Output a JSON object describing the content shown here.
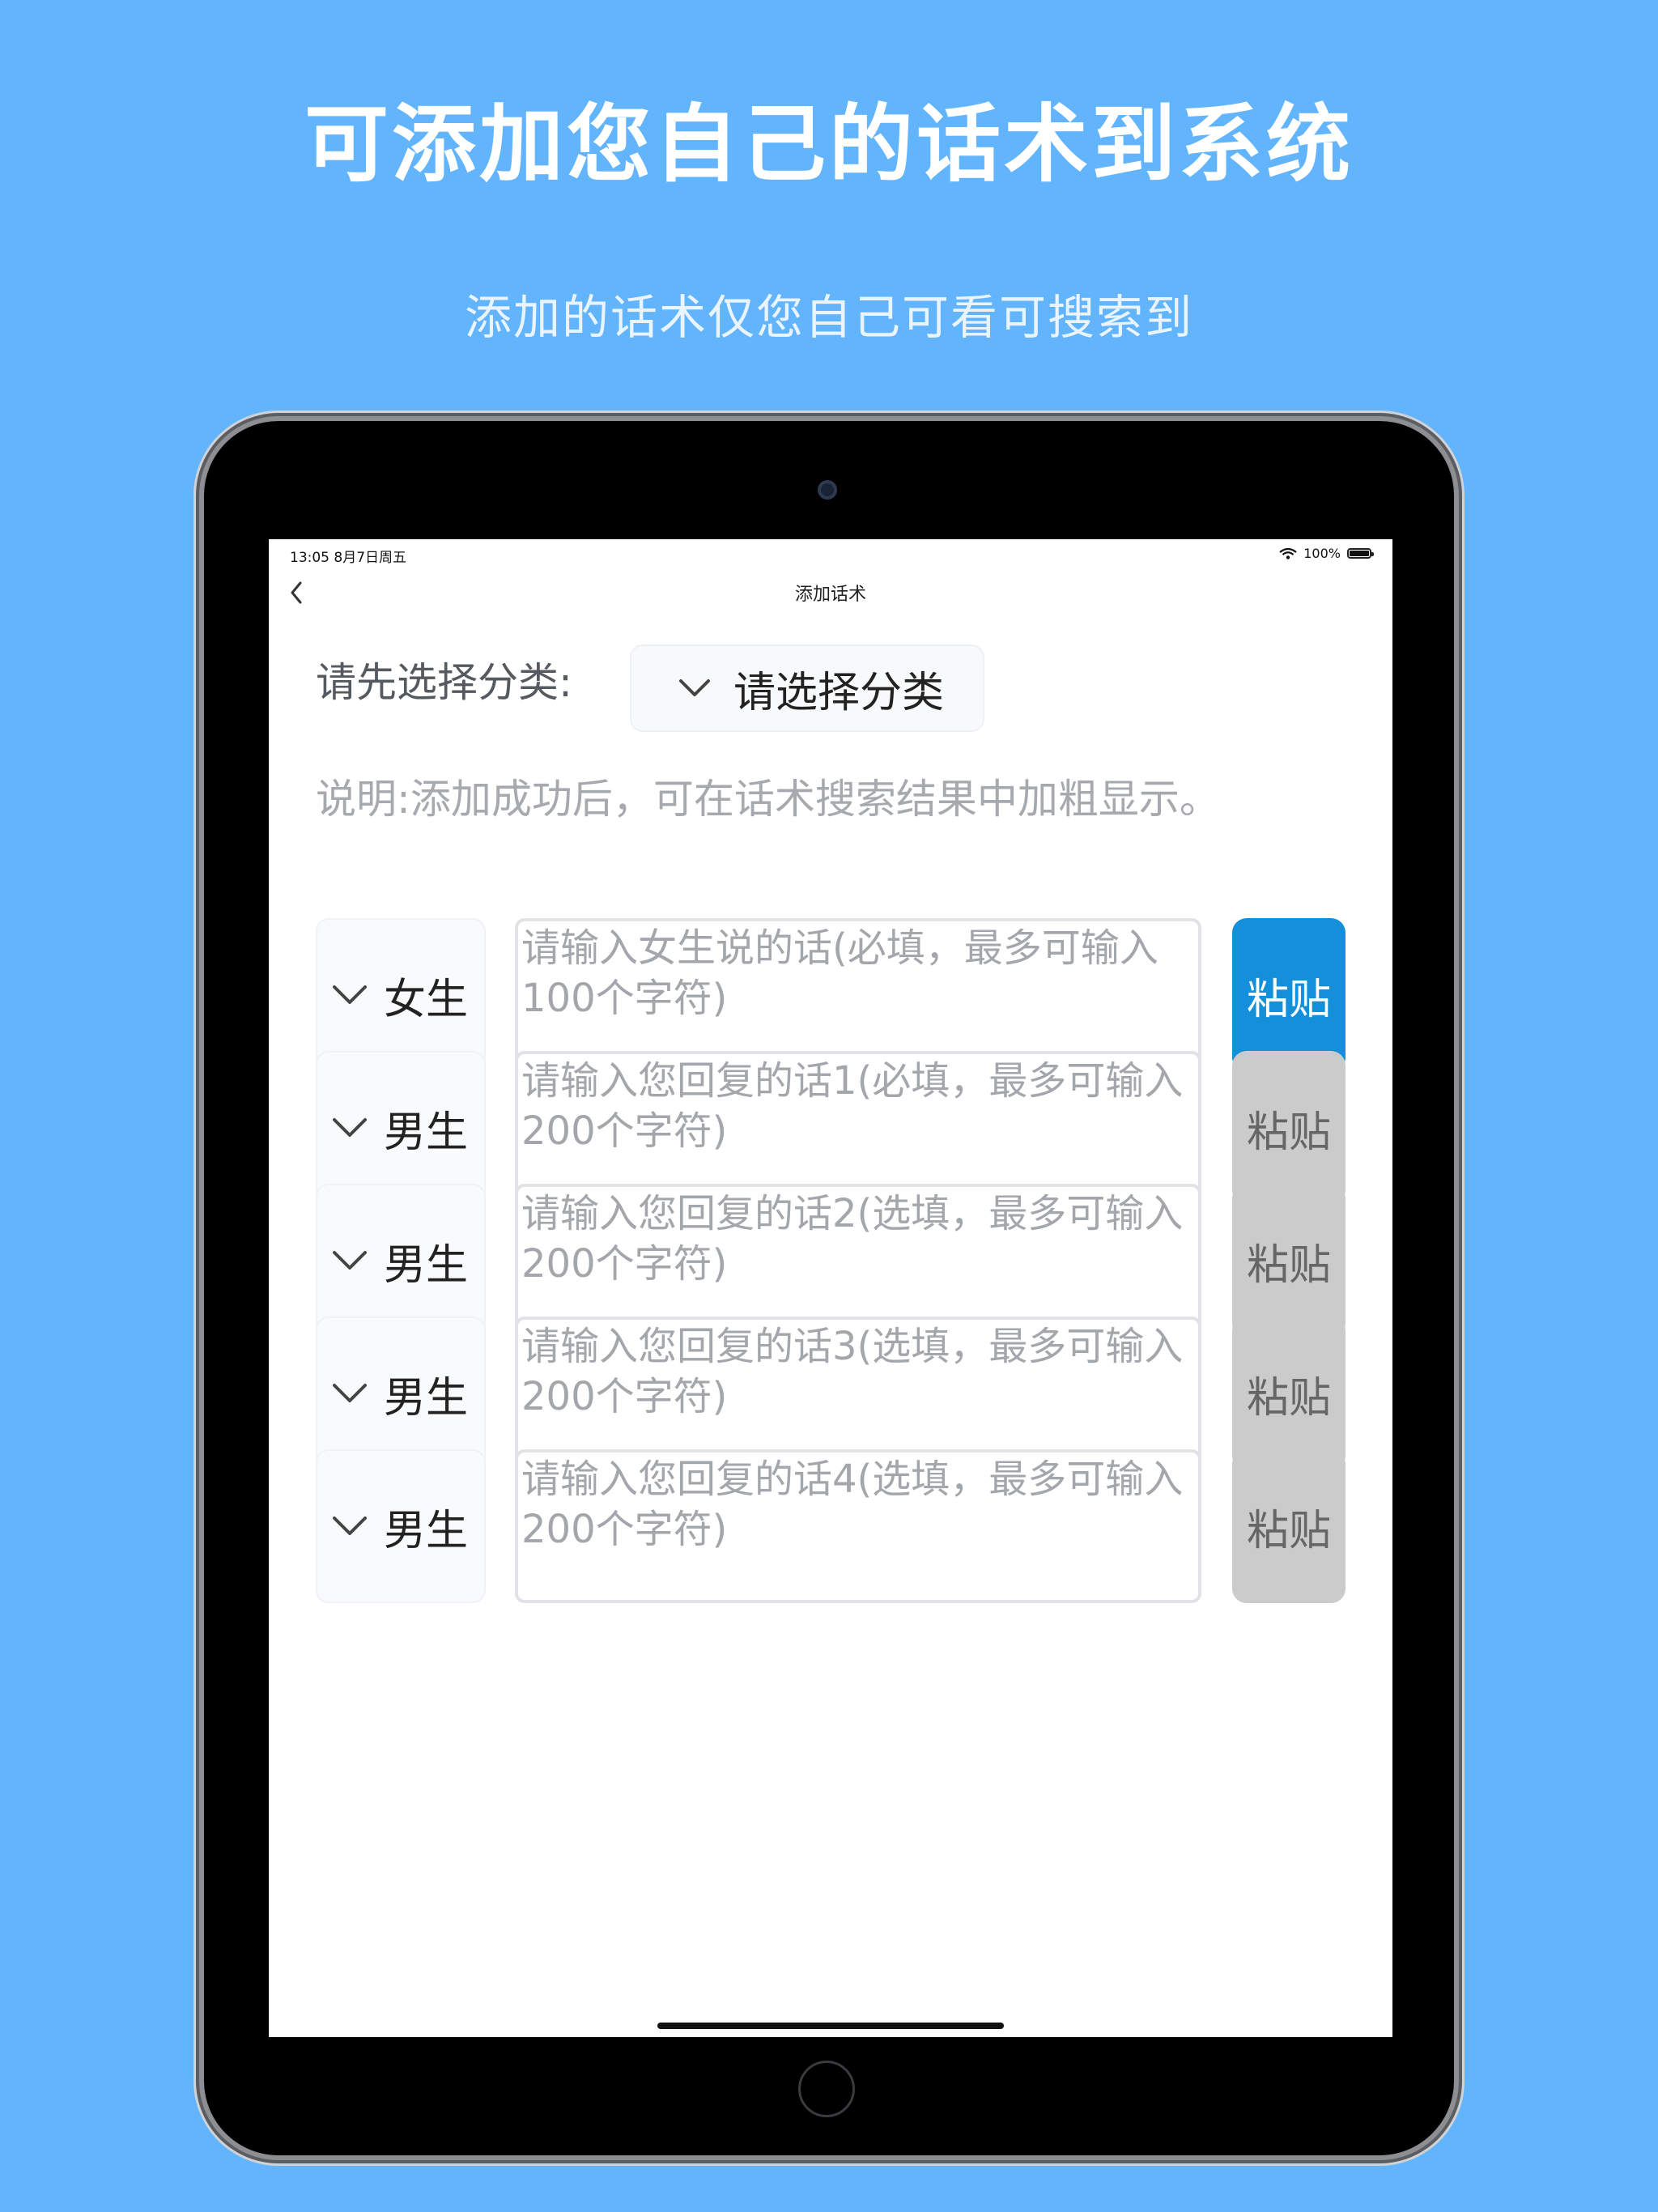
{
  "promo": {
    "headline": "可添加您自己的话术到系统",
    "subline": "添加的话术仅您自己可看可搜索到"
  },
  "statusbar": {
    "time": "13:05  8月7日周五",
    "battery": "100%"
  },
  "navbar": {
    "title": "添加话术",
    "back_icon": "chevron-left-icon"
  },
  "form": {
    "category_label": "请先选择分类:",
    "category_placeholder": "请选择分类",
    "note": "说明:添加成功后，可在话术搜索结果中加粗显示。",
    "rows": [
      {
        "gender": "女生",
        "placeholder": "请输入女生说的话(必填，最多可输入100个字符)",
        "paste_label": "粘贴",
        "paste_state": "active"
      },
      {
        "gender": "男生",
        "placeholder": "请输入您回复的话1(必填，最多可输入200个字符)",
        "paste_label": "粘贴",
        "paste_state": "disabled"
      },
      {
        "gender": "男生",
        "placeholder": "请输入您回复的话2(选填，最多可输入200个字符)",
        "paste_label": "粘贴",
        "paste_state": "disabled"
      },
      {
        "gender": "男生",
        "placeholder": "请输入您回复的话3(选填，最多可输入200个字符)",
        "paste_label": "粘贴",
        "paste_state": "disabled"
      },
      {
        "gender": "男生",
        "placeholder": "请输入您回复的话4(选填，最多可输入200个字符)",
        "paste_label": "粘贴",
        "paste_state": "disabled"
      }
    ]
  },
  "colors": {
    "background": "#62b5fd",
    "paste_active": "#1390d9",
    "paste_disabled": "#cbcbcb"
  }
}
